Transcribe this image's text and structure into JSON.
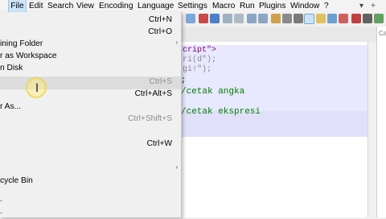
{
  "menubar": {
    "items": [
      "File",
      "Edit",
      "Search",
      "View",
      "Encoding",
      "Language",
      "Settings",
      "Macro",
      "Run",
      "Plugins",
      "Window",
      "?"
    ]
  },
  "file_menu": {
    "items": [
      {
        "label": "",
        "shortcut": "Ctrl+N"
      },
      {
        "label": "",
        "shortcut": "Ctrl+O"
      },
      {
        "label": "",
        "shortcut": ""
      },
      {
        "label": "ining Folder",
        "shortcut": ""
      },
      {
        "label": "r as Workspace",
        "shortcut": ""
      },
      {
        "label": "n Disk",
        "shortcut": ""
      },
      {
        "label": "",
        "shortcut": "Ctrl+S"
      },
      {
        "label": "",
        "shortcut": "Ctrl+Alt+S"
      },
      {
        "label": "r As...",
        "shortcut": ""
      },
      {
        "label": "",
        "shortcut": "Ctrl+Shift+S"
      },
      {
        "label": "",
        "shortcut": "Ctrl+W"
      },
      {
        "label": "cycle Bin",
        "shortcut": ""
      }
    ]
  },
  "editor": {
    "lines": [
      "cript\">",
      "ri(d\");",
      "gi!\");",
      ";",
      "/cetak angka",
      "/cetak ekspresi"
    ]
  },
  "right_panel": {
    "text": "Cari d"
  },
  "colors": {
    "accent": "#cce4f7",
    "comment": "#008000",
    "string": "#8a8a8a",
    "highlight": "#e8e8ff"
  }
}
